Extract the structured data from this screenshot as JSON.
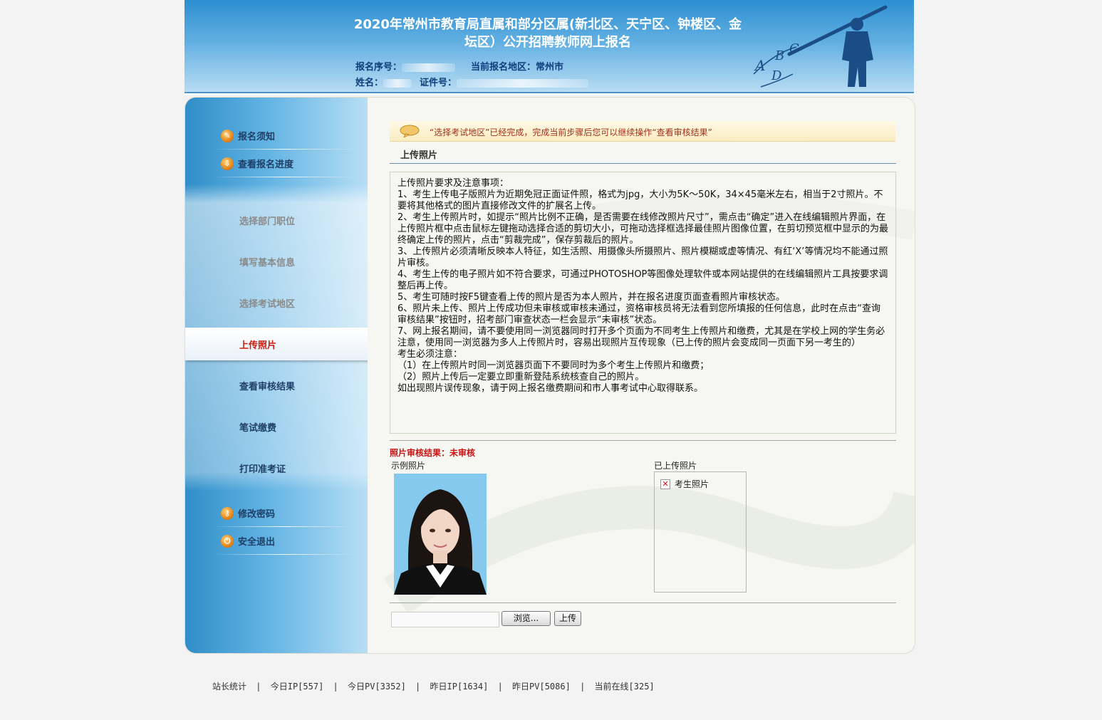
{
  "header": {
    "title": "2020年常州市教育局直属和部分区属(新北区、天宁区、钟楼区、金坛区）公开招聘教师网上报名",
    "reg_no_label": "报名序号：",
    "region_label": "当前报名地区：",
    "region_value": "常州市",
    "name_label": "姓名：",
    "id_label": "证件号："
  },
  "sidebar": {
    "top_items": [
      {
        "label": "报名须知",
        "icon": "pencil-icon"
      },
      {
        "label": "查看报名进度",
        "icon": "download-icon"
      }
    ],
    "steps": [
      {
        "label": "选择部门职位"
      },
      {
        "label": "填写基本信息"
      },
      {
        "label": "选择考试地区"
      },
      {
        "label": "上传照片"
      },
      {
        "label": "查看审核结果"
      },
      {
        "label": "笔试缴费"
      },
      {
        "label": "打印准考证"
      }
    ],
    "bottom_items": [
      {
        "label": "修改密码",
        "icon": "key-icon"
      },
      {
        "label": "安全退出",
        "icon": "power-icon"
      }
    ]
  },
  "notice": "“选择考试地区”已经完成，完成当前步骤后您可以继续操作“查看审核结果”",
  "section_title": "上传照片",
  "instructions": [
    "上传照片要求及注意事项：",
    "1、考生上传电子版照片为近期免冠正面证件照，格式为jpg，大小为5K～50K，34×45毫米左右，相当于2寸照片。不要将其他格式的图片直接修改文件的扩展名上传。",
    "2、考生上传照片时，如提示“照片比例不正确，是否需要在线修改照片尺寸”，需点击“确定”进入在线编辑照片界面，在上传照片框中点击鼠标左键拖动选择合适的剪切大小，可拖动选择框选择最佳照片图像位置，在剪切预览框中显示的为最终确定上传的照片，点击“剪裁完成”，保存剪裁后的照片。",
    "3、上传照片必须清晰反映本人特征，如生活照、用摄像头所摄照片、照片模糊或虚等情况、有红‘X’等情况均不能通过照片审核。",
    "4、考生上传的电子照片如不符合要求，可通过PHOTOSHOP等图像处理软件或本网站提供的在线编辑照片工具按要求调整后再上传。",
    "5、考生可随时按F5键查看上传的照片是否为本人照片，并在报名进度页面查看照片审核状态。",
    "6、照片未上传、照片上传成功但未审核或审核未通过，资格审核员将无法看到您所填报的任何信息，此时在点击“查询审核结果”按钮时，招考部门审查状态一栏会显示“未审核”状态。",
    "7、网上报名期间，请不要使用同一浏览器同时打开多个页面为不同考生上传照片和缴费，尤其是在学校上网的学生务必注意，使用同一浏览器为多人上传照片时，容易出现照片互传现象（已上传的照片会变成同一页面下另一考生的）",
    "考生必须注意：",
    "（1）在上传照片时同一浏览器页面下不要同时为多个考生上传照片和缴费；",
    "（2）照片上传后一定要立即重新登陆系统核查自己的照片。",
    "如出现照片误传现象，请于网上报名缴费期间和市人事考试中心取得联系。"
  ],
  "photo_result": "照片审核结果：未审核",
  "sample_label": "示例照片",
  "uploaded_label": "已上传照片",
  "uploaded_alt": "考生照片",
  "browse_button": "浏览...",
  "upload_button": "上传",
  "footer": {
    "stats_label": "站长统计",
    "items": [
      "今日IP[557]",
      "今日PV[3352]",
      "昨日IP[1634]",
      "昨日PV[5086]",
      "当前在线[325]"
    ]
  }
}
